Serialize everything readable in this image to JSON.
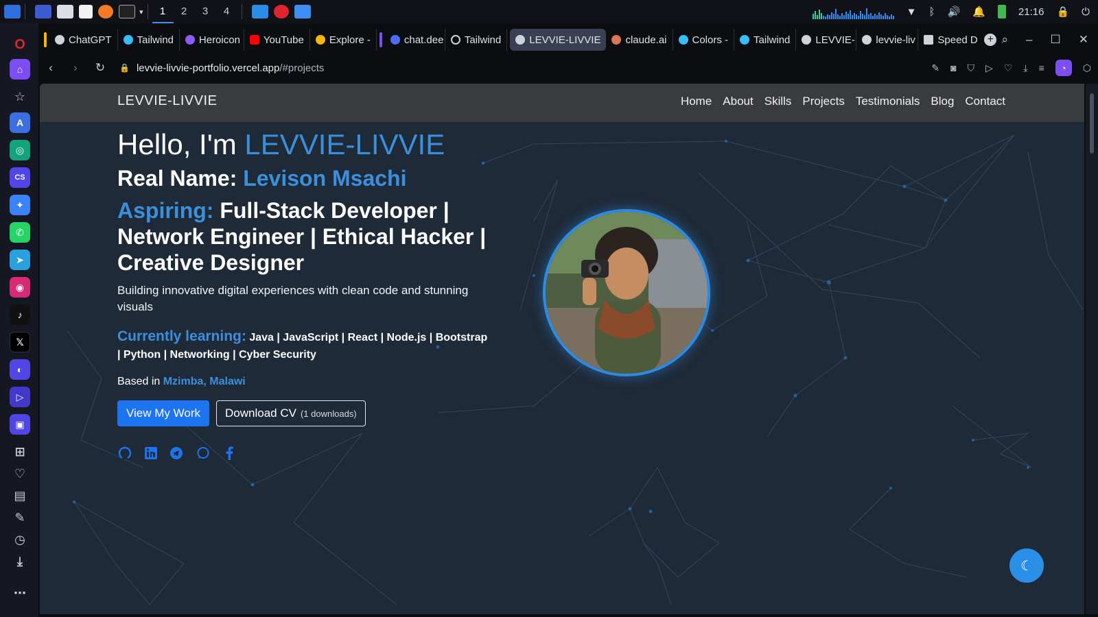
{
  "os": {
    "workspaces": [
      "1",
      "2",
      "3",
      "4"
    ],
    "clock": "21:16"
  },
  "tabs": [
    {
      "label": "ChatGPT",
      "color": "#cfd2d8"
    },
    {
      "label": "Tailwind",
      "color": "#38bdf8"
    },
    {
      "label": "Heroicon",
      "color": "#8b5cf6"
    },
    {
      "label": "YouTube",
      "color": "#ff0000"
    },
    {
      "label": "Explore -",
      "color": "#f5b700"
    },
    {
      "label": "chat.dee",
      "color": "#4d6bfe"
    },
    {
      "label": "Tailwind",
      "color": "#cfd2d8"
    },
    {
      "label": "LEVVIE-LIVVIE",
      "color": "#cfd2d8"
    },
    {
      "label": "claude.ai",
      "color": "#d97757"
    },
    {
      "label": "Colors -",
      "color": "#38bdf8"
    },
    {
      "label": "Tailwind",
      "color": "#38bdf8"
    },
    {
      "label": "LEVVIE-L",
      "color": "#cfd2d8"
    },
    {
      "label": "levvie-liv",
      "color": "#cfd2d8"
    },
    {
      "label": "Speed D",
      "color": "#cfd2d8"
    }
  ],
  "address": {
    "domain": "levvie-livvie-portfolio.vercel.app",
    "path": "/#projects"
  },
  "site": {
    "brand": "LEVVIE-LIVVIE",
    "nav": [
      "Home",
      "About",
      "Skills",
      "Projects",
      "Testimonials",
      "Blog",
      "Contact"
    ],
    "greeting": "Hello, I'm",
    "name": "LEVVIE-LIVVIE",
    "real_name_label": "Real Name:",
    "real_name": "Levison Msachi",
    "aspiring_label": "Aspiring:",
    "roles": "Full-Stack Developer | Network Engineer | Ethical Hacker | Creative Designer",
    "tagline": "Building innovative digital experiences with clean code and stunning visuals",
    "learning_label": "Currently learning:",
    "learning": "Java | JavaScript | React | Node.js | Bootstrap | Python | Networking | Cyber Security",
    "based_label": "Based in",
    "location": "Mzimba, Malawi",
    "cta_primary": "View My Work",
    "cta_secondary": "Download CV",
    "downloads": "(1 downloads)"
  }
}
